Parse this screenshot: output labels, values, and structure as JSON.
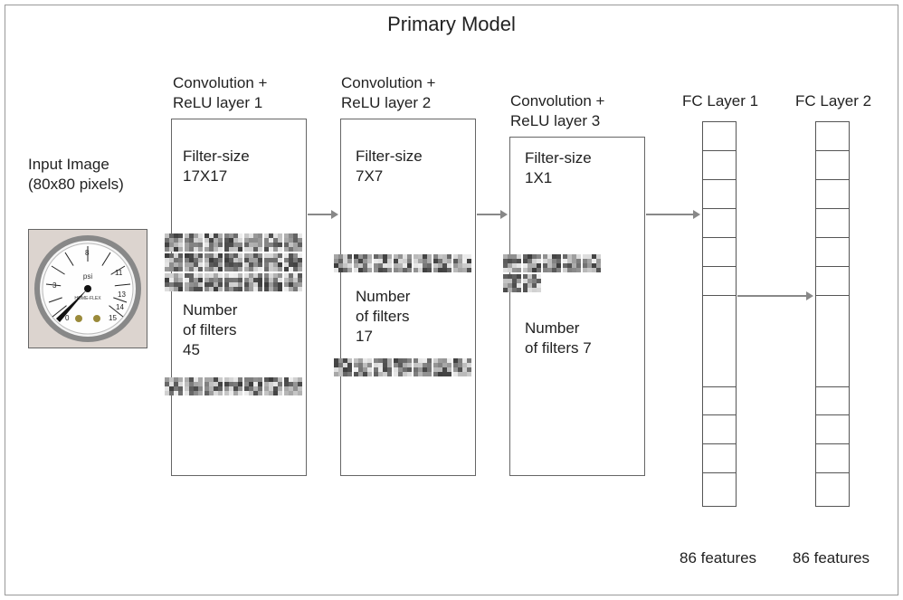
{
  "title": "Primary Model",
  "input": {
    "label_line1": "Input Image",
    "label_line2": "(80x80 pixels)"
  },
  "layers": {
    "conv1": {
      "title_line1": "Convolution +",
      "title_line2": "ReLU layer 1",
      "filter_size_label": "Filter-size",
      "filter_size_value": "17X17",
      "num_filters_label": "Number",
      "num_filters_label2": "of filters",
      "num_filters_value": "45"
    },
    "conv2": {
      "title_line1": "Convolution +",
      "title_line2": "ReLU layer 2",
      "filter_size_label": "Filter-size",
      "filter_size_value": "7X7",
      "num_filters_label": "Number",
      "num_filters_label2": "of filters",
      "num_filters_value": "17"
    },
    "conv3": {
      "title_line1": "Convolution +",
      "title_line2": "ReLU layer 3",
      "filter_size_label": "Filter-size",
      "filter_size_value": "1X1",
      "num_filters_label": "Number",
      "num_filters_label2": "of filters 7"
    },
    "fc1": {
      "title": "FC Layer 1",
      "features": "86 features"
    },
    "fc2": {
      "title": "FC Layer 2",
      "features": "86 features"
    }
  },
  "gauge": {
    "unit": "psi",
    "brand": "HOME-FLEX"
  }
}
